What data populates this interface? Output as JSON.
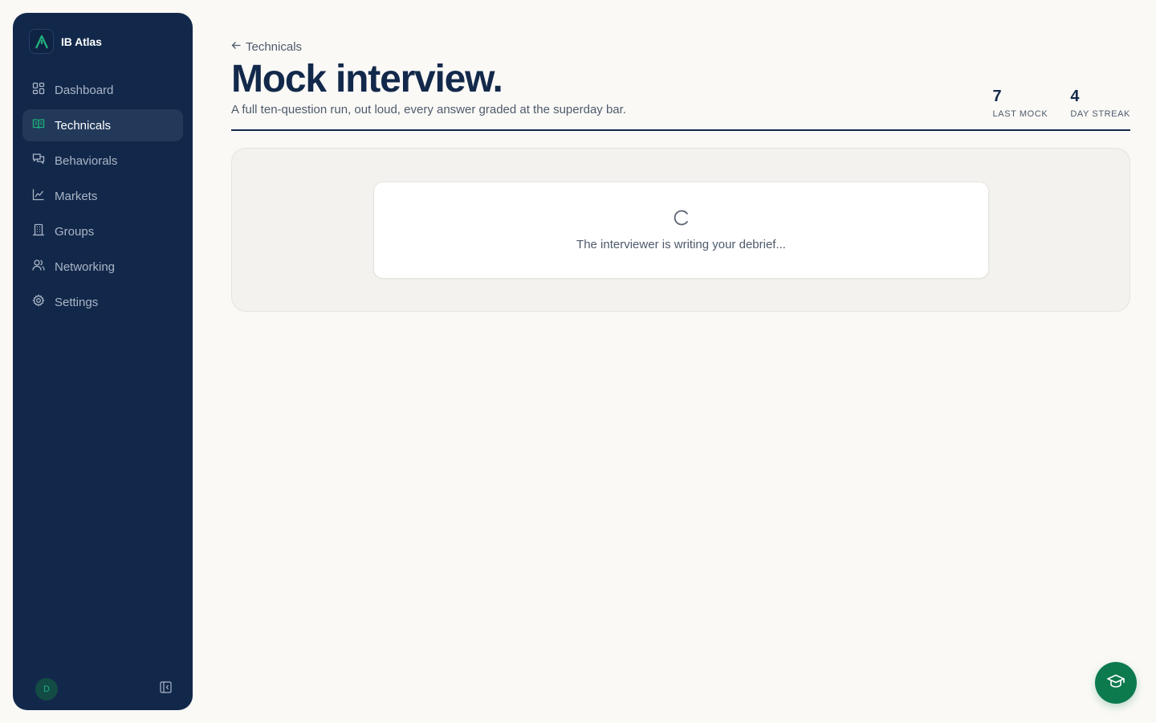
{
  "brand": {
    "name": "IB Atlas",
    "accent": "#1fae7b"
  },
  "sidebar": {
    "items": [
      {
        "label": "Dashboard",
        "icon": "dashboard-icon",
        "active": false
      },
      {
        "label": "Technicals",
        "icon": "book-icon",
        "active": true
      },
      {
        "label": "Behaviorals",
        "icon": "chat-icon",
        "active": false
      },
      {
        "label": "Markets",
        "icon": "chart-icon",
        "active": false
      },
      {
        "label": "Groups",
        "icon": "building-icon",
        "active": false
      },
      {
        "label": "Networking",
        "icon": "users-icon",
        "active": false
      },
      {
        "label": "Settings",
        "icon": "gear-icon",
        "active": false
      }
    ],
    "avatar_initial": "D"
  },
  "header": {
    "back_label": "Technicals",
    "title": "Mock interview.",
    "subtitle": "A full ten-question run, out loud, every answer graded at the superday bar.",
    "stats": [
      {
        "value": "7",
        "label": "LAST MOCK"
      },
      {
        "value": "4",
        "label": "DAY STREAK"
      }
    ]
  },
  "loading": {
    "text": "The interviewer is writing your debrief..."
  },
  "fab": {
    "icon": "graduation-cap-icon",
    "color": "#0d7a4e"
  }
}
